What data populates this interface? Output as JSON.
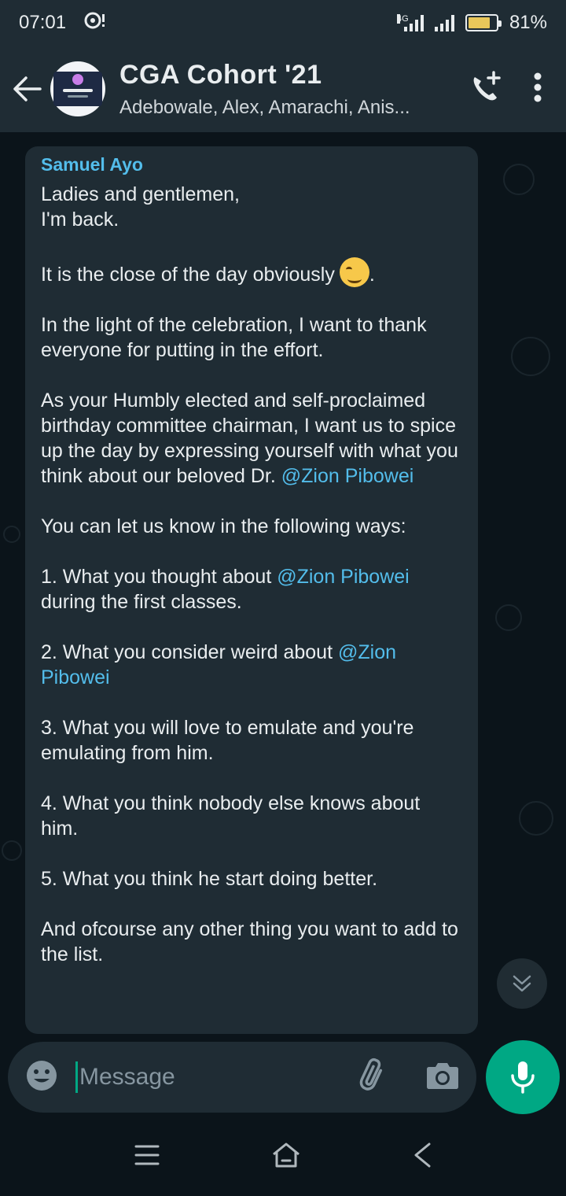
{
  "status_bar": {
    "time": "07:01",
    "network": "4G",
    "battery_percent": "81%",
    "battery_level": 0.81
  },
  "header": {
    "title": "CGA Cohort '21",
    "subtitle": "Adebowale, Alex, Amarachi, Anis...",
    "icons": [
      "back-arrow-icon",
      "group-avatar",
      "add-call-icon",
      "more-vert-icon"
    ]
  },
  "message": {
    "sender": "Samuel Ayo",
    "paragraphs": {
      "p1_line1": "Ladies and gentlemen,",
      "p1_line2": "I'm back.",
      "p2": "It is the close of the day obviously",
      "p2_end": ".",
      "p3": "In the light of the celebration, I want to thank everyone for putting in the effort.",
      "p4": "As your Humbly elected and self-proclaimed birthday committee chairman, I want us to spice up the day by expressing yourself with what you think about our beloved Dr.",
      "p5": "You can let us know in the following ways:",
      "item1": "1. What you thought about",
      "item1_end": "during the first classes.",
      "item2": "2. What you consider weird about",
      "item3": "3. What you will love to emulate and you're emulating from him.",
      "item4": "4. What you think nobody else knows about him.",
      "item5": "5. What you think he start doing better.",
      "p6": "And ofcourse any other thing you want to add to the list."
    },
    "mention": "@Zion Pibowei"
  },
  "input": {
    "placeholder": "Message"
  },
  "colors": {
    "accent": "#00a884",
    "mention": "#53bdeb",
    "bubble": "#1f2c34",
    "background": "#0b141a"
  }
}
